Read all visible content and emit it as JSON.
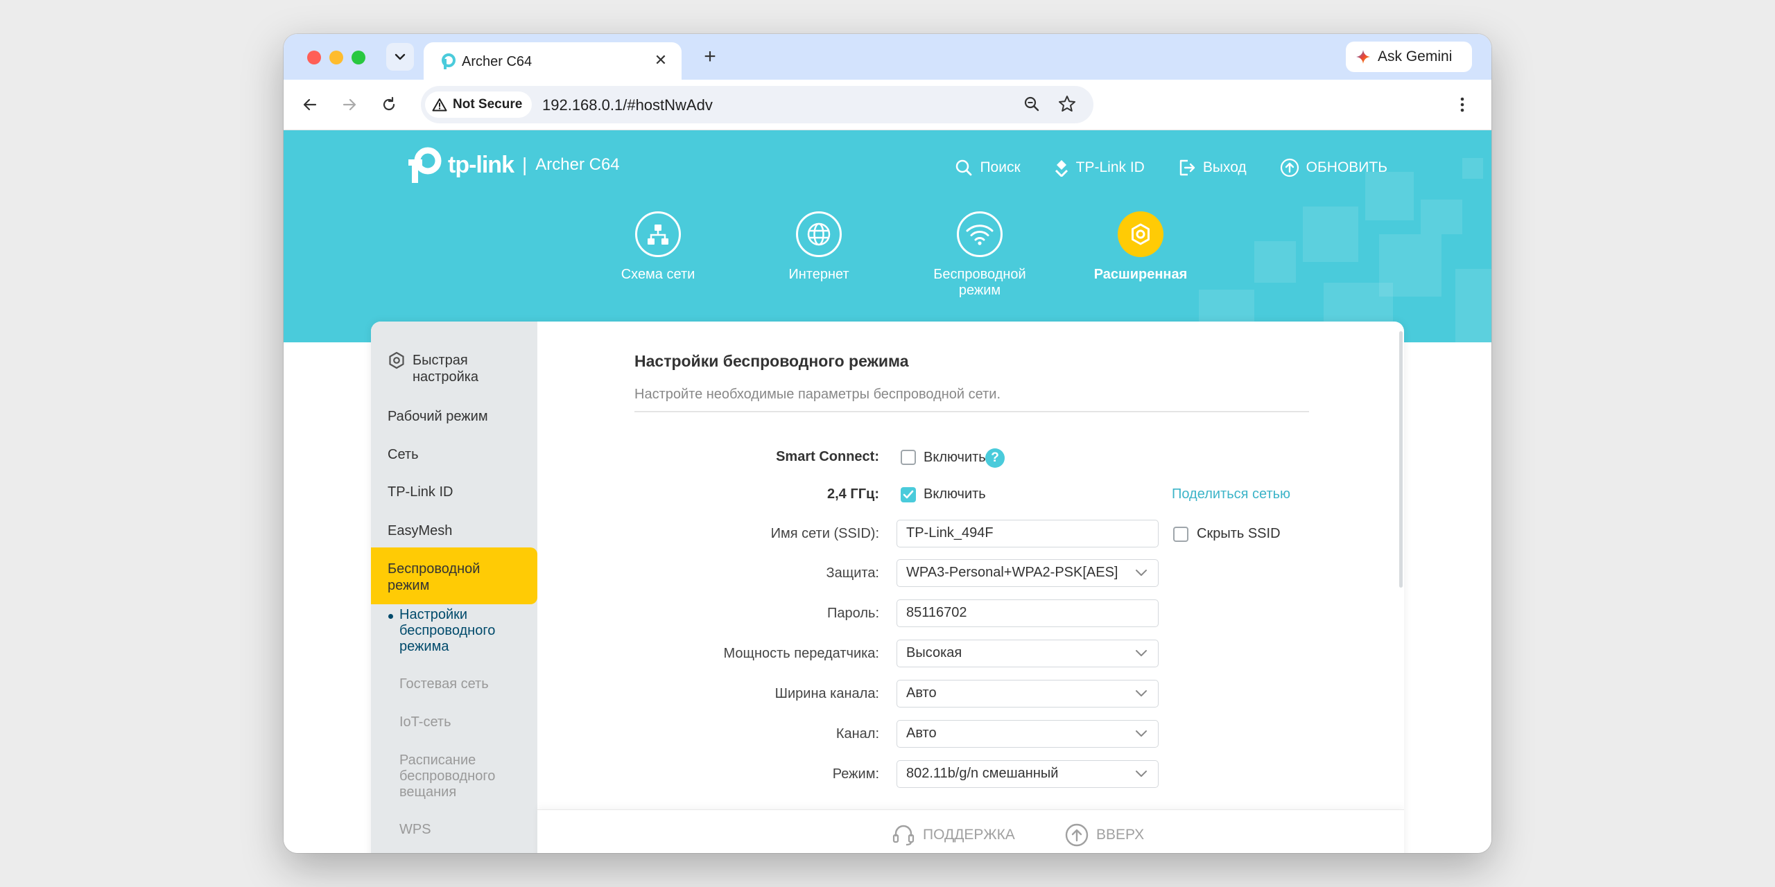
{
  "browser": {
    "tab_title": "Archer C64",
    "tab_close": "✕",
    "new_tab": "+",
    "gemini_label": "Ask Gemini",
    "security_label": "Not Secure",
    "url": "192.168.0.1/#hostNwAdv"
  },
  "header": {
    "logo_text": "tp-link",
    "logo_separator": "|",
    "model": "Archer C64",
    "links": {
      "search": "Поиск",
      "tplink_id": "TP-Link ID",
      "logout": "Выход",
      "update": "ОБНОВИТЬ"
    }
  },
  "nav": {
    "network_map": "Схема сети",
    "internet": "Интернет",
    "wireless_line1": "Беспроводной",
    "wireless_line2": "режим",
    "advanced": "Расширенная"
  },
  "sidebar": {
    "quick_setup_line1": "Быстрая",
    "quick_setup_line2": "настройка",
    "operation_mode": "Рабочий режим",
    "network": "Сеть",
    "tplink_id": "TP-Link ID",
    "easymesh": "EasyMesh",
    "wireless_line1": "Беспроводной",
    "wireless_line2": "режим",
    "sub_wireless_settings_l1": "Настройки",
    "sub_wireless_settings_l2": "беспроводного",
    "sub_wireless_settings_l3": "режима",
    "sub_guest": "Гостевая сеть",
    "sub_iot": "IoT-сеть",
    "sub_schedule_l1": "Расписание",
    "sub_schedule_l2": "беспроводного",
    "sub_schedule_l3": "вещания",
    "sub_wps": "WPS"
  },
  "content": {
    "title": "Настройки беспроводного режима",
    "subtitle": "Настройте необходимые параметры беспроводной сети.",
    "smart_connect_label": "Smart Connect:",
    "smart_connect_checkbox": "Включить",
    "smart_connect_checked": false,
    "help_glyph": "?",
    "band_label": "2,4 ГГц:",
    "band_checkbox": "Включить",
    "band_checked": true,
    "share_network": "Поделиться сетью",
    "ssid_label": "Имя сети (SSID):",
    "ssid_value": "TP-Link_494F",
    "hide_ssid": "Скрыть SSID",
    "hide_ssid_checked": false,
    "security_label": "Защита:",
    "security_value": "WPA3-Personal+WPA2-PSK[AES]",
    "password_label": "Пароль:",
    "password_value": "85116702",
    "tx_power_label": "Мощность передатчика:",
    "tx_power_value": "Высокая",
    "channel_width_label": "Ширина канала:",
    "channel_width_value": "Авто",
    "channel_label": "Канал:",
    "channel_value": "Авто",
    "mode_label": "Режим:",
    "mode_value": "802.11b/g/n смешанный"
  },
  "footer": {
    "support": "ПОДДЕРЖКА",
    "back_to_top": "ВВЕРХ"
  },
  "colors": {
    "brand_teal": "#4acbdb",
    "brand_yellow": "#ffcb05",
    "sidebar_bg": "#e5e8ea",
    "link": "#3cb4c8"
  }
}
